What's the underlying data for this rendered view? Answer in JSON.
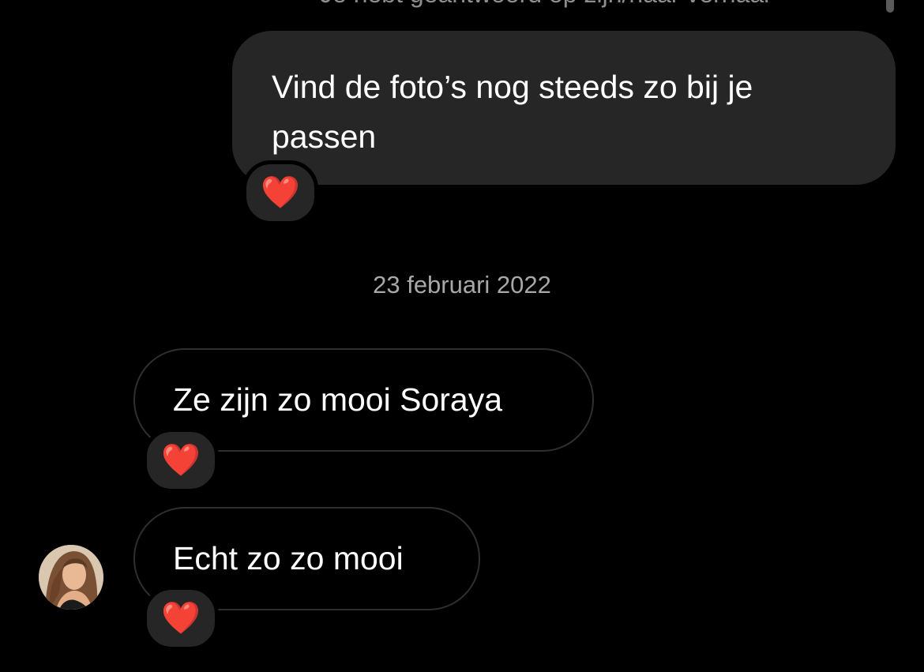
{
  "header": {
    "cut_status_text": "Je hebt geantwoord op zijn/haar verhaal"
  },
  "messages": [
    {
      "direction": "outgoing",
      "text": "Vind de foto’s nog steeds zo bij je passen",
      "reaction": "❤️"
    },
    {
      "direction": "incoming",
      "text": "Ze zijn zo mooi Soraya",
      "reaction": "❤️"
    },
    {
      "direction": "incoming",
      "text": "Echt zo zo mooi",
      "reaction": "❤️"
    }
  ],
  "date_separator": "23 februari 2022",
  "colors": {
    "background": "#000000",
    "outgoing_bubble": "#262626",
    "incoming_bubble_border": "#2f2f2f",
    "date_text": "#a8a8a8",
    "reaction": "#ff2a3a"
  },
  "icons": {
    "reaction": "heart-icon",
    "sender": "avatar"
  }
}
